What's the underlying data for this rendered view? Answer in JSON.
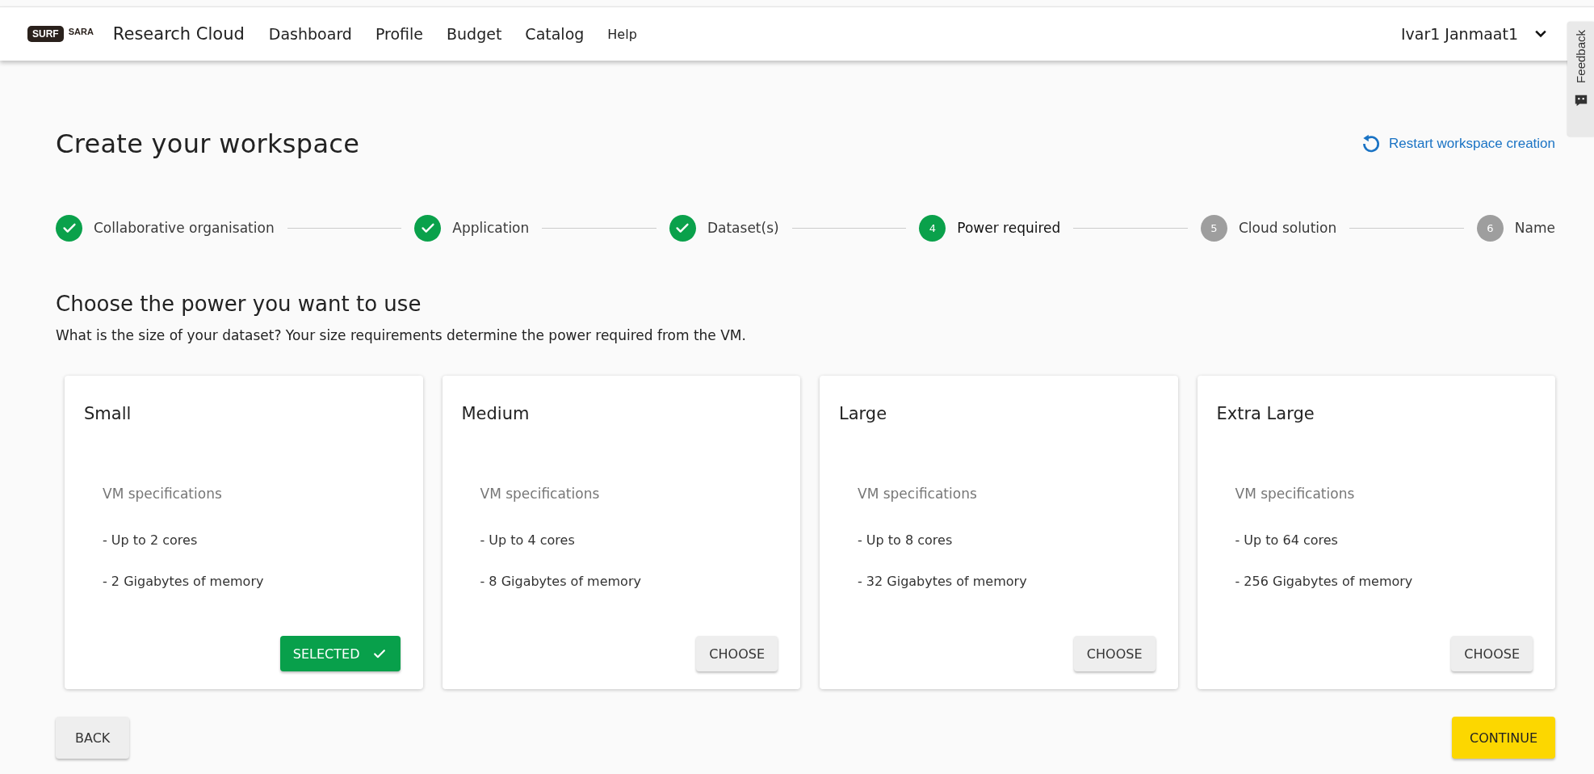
{
  "header": {
    "logo": {
      "left": "SURF",
      "right": "SARA"
    },
    "app_title": "Research Cloud",
    "nav": [
      "Dashboard",
      "Profile",
      "Budget",
      "Catalog",
      "Help"
    ],
    "user": "Ivar1 Janmaat1"
  },
  "feedback_tab": {
    "label": "Feedback"
  },
  "page_title": "Create your workspace",
  "restart_link": "Restart workspace creation",
  "steps": [
    {
      "label": "Collaborative organisation",
      "completed": true,
      "selected": false
    },
    {
      "label": "Application",
      "completed": true,
      "selected": false
    },
    {
      "label": "Dataset(s)",
      "completed": true,
      "selected": false
    },
    {
      "number": "4",
      "label": "Power required",
      "completed": false,
      "selected": true
    },
    {
      "number": "5",
      "label": "Cloud solution",
      "completed": false,
      "selected": false
    },
    {
      "number": "6",
      "label": "Name",
      "completed": false,
      "selected": false
    }
  ],
  "section_title": "Choose the power you want to use",
  "section_text": "What is the size of your dataset? Your size requirements determine the power required from the VM.",
  "cards": [
    {
      "title": "Small",
      "spec_heading": "VM specifications",
      "specs": [
        "- Up to 2 cores",
        "- 2 Gigabytes of memory"
      ],
      "button": "SELECTED",
      "selected": true
    },
    {
      "title": "Medium",
      "spec_heading": "VM specifications",
      "specs": [
        "- Up to 4 cores",
        "- 8 Gigabytes of memory"
      ],
      "button": "CHOOSE",
      "selected": false
    },
    {
      "title": "Large",
      "spec_heading": "VM specifications",
      "specs": [
        "- Up to 8 cores",
        "- 32 Gigabytes of memory"
      ],
      "button": "CHOOSE",
      "selected": false
    },
    {
      "title": "Extra Large",
      "spec_heading": "VM specifications",
      "specs": [
        "- Up to 64 cores",
        "- 256 Gigabytes of memory"
      ],
      "button": "CHOOSE",
      "selected": false
    }
  ],
  "back_button": "BACK",
  "continue_button": "CONTINUE"
}
